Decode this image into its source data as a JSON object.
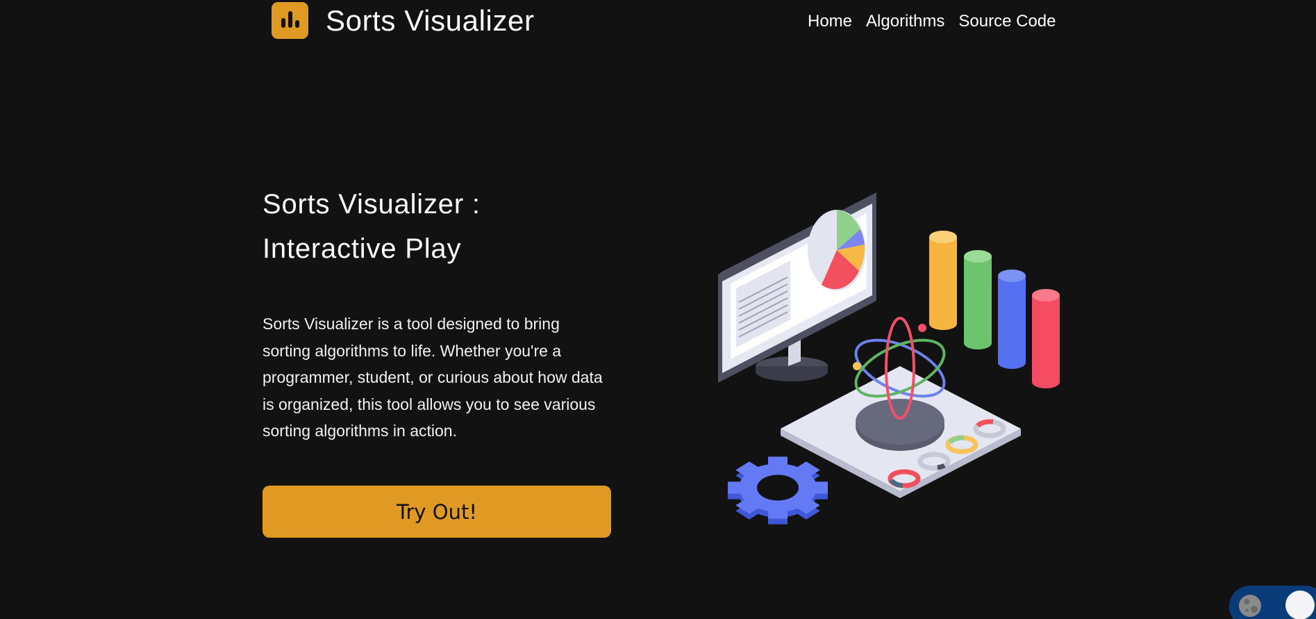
{
  "header": {
    "brand_title": "Sorts Visualizer",
    "logo_icon": "bar-chart-icon",
    "nav": [
      {
        "label": "Home"
      },
      {
        "label": "Algorithms"
      },
      {
        "label": "Source Code"
      }
    ]
  },
  "hero": {
    "title_line1": "Sorts Visualizer :",
    "title_line2": "Interactive Play",
    "description": "Sorts Visualizer is a tool designed to bring sorting algorithms to life. Whether you're a programmer, student, or curious about how data is organized, this tool allows you to see various sorting algorithms in action.",
    "cta_label": "Try Out!",
    "illustration_icon": "computer-analytics-illustration"
  },
  "theme_toggle": {
    "icon": "moon-icon",
    "state": "dark"
  },
  "colors": {
    "background": "#121212",
    "accent": "#e09a23",
    "text": "#ffffff",
    "toggle_track": "#0a3c7a"
  }
}
